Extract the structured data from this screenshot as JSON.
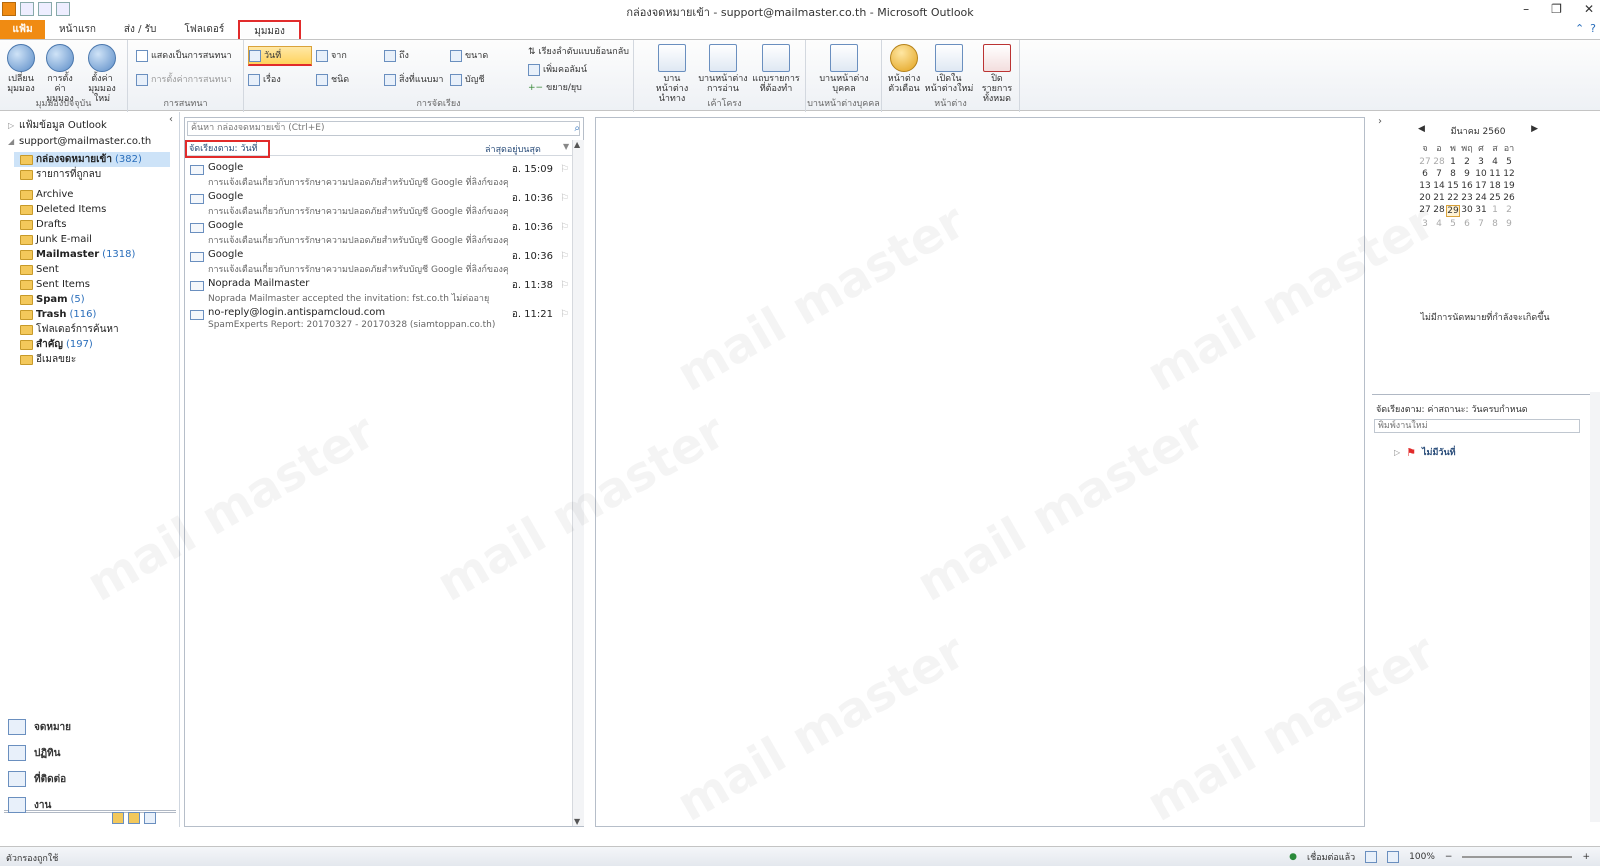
{
  "window": {
    "title": "กล่องจดหมายเข้า - support@mailmaster.co.th - Microsoft Outlook",
    "controls": [
      "–",
      "❐",
      "✕"
    ]
  },
  "ribbon_tabs": [
    "แฟ้ม",
    "หน้าแรก",
    "ส่ง / รับ",
    "โฟลเดอร์",
    "มุมมอง"
  ],
  "ribbon": {
    "current_view": {
      "label": "มุมมองปัจจุบัน",
      "change_view": "เปลี่ยน\nมุมมอง",
      "view_settings": "การตั้งค่า\nมุมมอง",
      "reset_view": "ตั้งค่า\nมุมมองใหม่"
    },
    "conversations": {
      "label": "การสนทนา",
      "show_as_conversations": "แสดงเป็นการสนทนา",
      "conversation_settings": "การตั้งค่าการสนทนา"
    },
    "arrangement": {
      "label": "การจัดเรียง",
      "date": "วันที่",
      "from": "จาก",
      "to": "ถึง",
      "size": "ขนาด",
      "subject": "เรื่อง",
      "type": "ชนิด",
      "attachments": "สิ่งที่แนบมา",
      "account": "บัญชี",
      "reverse_sort": "เรียงลำดับแบบย้อนกลับ",
      "add_columns": "เพิ่มคอลัมน์",
      "expand_collapse": "ขยาย/ยุบ"
    },
    "layout": {
      "label": "เค้าโครง",
      "folder_pane": "บานหน้าต่าง\nนำทาง",
      "reading_pane": "บานหน้าต่าง\nการอ่าน",
      "todo_bar": "แถบรายการ\nที่ต้องทำ"
    },
    "people_pane": {
      "label": "บานหน้าต่างบุคคล",
      "people_pane": "บานหน้าต่าง\nบุคคล"
    },
    "window": {
      "label": "หน้าต่าง",
      "reminders": "หน้าต่าง\nตัวเตือน",
      "open_new_window": "เปิดใน\nหน้าต่างใหม่",
      "close_all": "ปิดรายการ\nทั้งหมด"
    }
  },
  "folders": {
    "favorites": "แฟ้มข้อมูล Outlook",
    "account": "support@mailmaster.co.th",
    "items": [
      {
        "name": "กล่องจดหมายเข้า",
        "count": "(382)",
        "bold": true,
        "selected": true
      },
      {
        "name": "รายการที่ถูกลบ",
        "count": ""
      },
      {
        "name": "Archive",
        "count": ""
      },
      {
        "name": "Deleted Items",
        "count": ""
      },
      {
        "name": "Drafts",
        "count": ""
      },
      {
        "name": "Junk E-mail",
        "count": ""
      },
      {
        "name": "Mailmaster",
        "count": "(1318)",
        "bold": true
      },
      {
        "name": "Sent",
        "count": ""
      },
      {
        "name": "Sent Items",
        "count": ""
      },
      {
        "name": "Spam",
        "count": "(5)",
        "bold": true
      },
      {
        "name": "Trash",
        "count": "(116)",
        "bold": true
      },
      {
        "name": "โฟลเดอร์การค้นหา",
        "count": ""
      },
      {
        "name": "สำคัญ",
        "count": "(197)",
        "bold": true
      },
      {
        "name": "อีเมลขยะ",
        "count": ""
      }
    ]
  },
  "nav": [
    "จดหมาย",
    "ปฏิทิน",
    "ที่ติดต่อ",
    "งาน"
  ],
  "search": {
    "placeholder": "ค้นหา กล่องจดหมายเข้า (Ctrl+E)"
  },
  "list": {
    "arranged_by": "จัดเรียงตาม: วันที่",
    "sort_order": "ล่าสุดอยู่บนสุด",
    "messages": [
      {
        "from": "Google",
        "date": "อ. 15:09",
        "preview": "การแจ้งเตือนเกี่ยวกับการรักษาความปลอดภัยสำหรับบัญชี Google ที่ลิงก์ของคุณ"
      },
      {
        "from": "Google",
        "date": "อ. 10:36",
        "preview": "การแจ้งเตือนเกี่ยวกับการรักษาความปลอดภัยสำหรับบัญชี Google ที่ลิงก์ของคุณ"
      },
      {
        "from": "Google",
        "date": "อ. 10:36",
        "preview": "การแจ้งเตือนเกี่ยวกับการรักษาความปลอดภัยสำหรับบัญชี Google ที่ลิงก์ของคุณ"
      },
      {
        "from": "Google",
        "date": "อ. 10:36",
        "preview": "การแจ้งเตือนเกี่ยวกับการรักษาความปลอดภัยสำหรับบัญชี Google ที่ลิงก์ของคุณ"
      },
      {
        "from": "Noprada Mailmaster",
        "date": "อ. 11:38",
        "preview": "Noprada Mailmaster accepted the invitation: fst.co.th ไม่ต่ออายุ"
      },
      {
        "from": "no-reply@login.antispamcloud.com",
        "date": "อ. 11:21",
        "preview": "SpamExperts Report: 20170327 - 20170328 (siamtoppan.co.th)"
      }
    ]
  },
  "calendar": {
    "month": "มีนาคม 2560",
    "headers": [
      "จ",
      "อ",
      "พ",
      "พฤ",
      "ศ",
      "ส",
      "อา"
    ],
    "weeks": [
      [
        "27",
        "28",
        "1",
        "2",
        "3",
        "4",
        "5"
      ],
      [
        "6",
        "7",
        "8",
        "9",
        "10",
        "11",
        "12"
      ],
      [
        "13",
        "14",
        "15",
        "16",
        "17",
        "18",
        "19"
      ],
      [
        "20",
        "21",
        "22",
        "23",
        "24",
        "25",
        "26"
      ],
      [
        "27",
        "28",
        "29",
        "30",
        "31",
        "1",
        "2"
      ],
      [
        "3",
        "4",
        "5",
        "6",
        "7",
        "8",
        "9"
      ]
    ],
    "today": "29",
    "no_appointments": "ไม่มีการนัดหมายที่กำลังจะเกิดขึ้น"
  },
  "tasks": {
    "arranged_by": "จัดเรียงตาม: ค่าสถานะ: วันครบกำหนด",
    "new_task_placeholder": "พิมพ์งานใหม่",
    "group": "ไม่มีวันที่"
  },
  "status": {
    "left": "ตัวกรองถูกใช้",
    "connection": "เชื่อมต่อแล้ว",
    "zoom": "100%"
  },
  "colors": {
    "accent": "#f08b12",
    "highlight": "#e12b2b",
    "link": "#2a6ebb"
  }
}
